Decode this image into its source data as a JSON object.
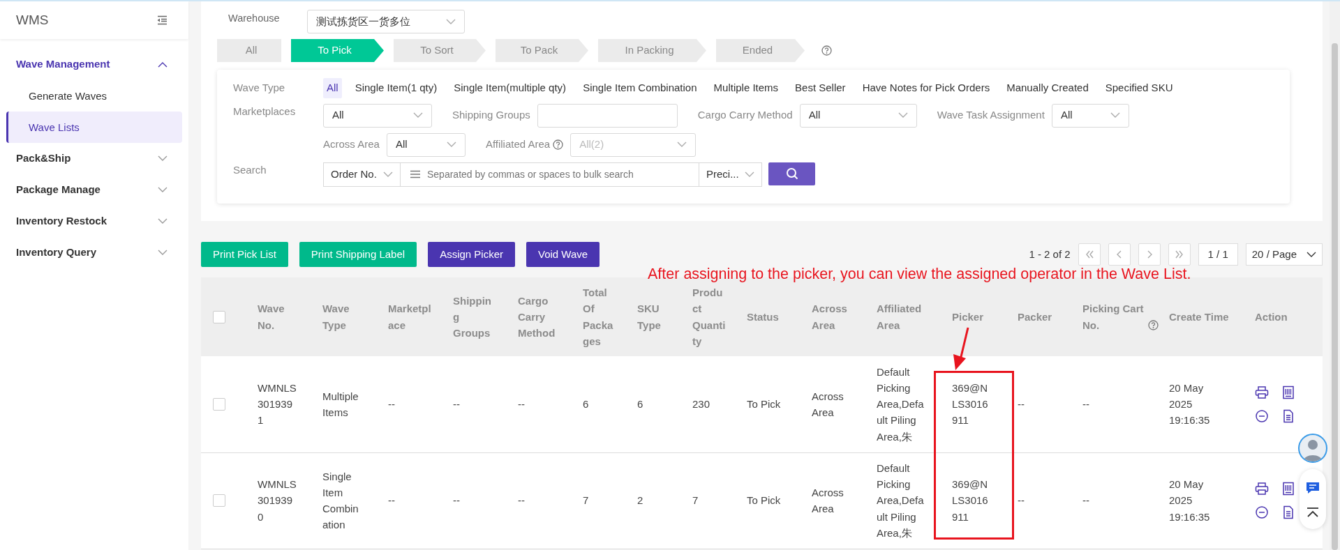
{
  "sidebar": {
    "title": "WMS",
    "items": [
      {
        "label": "Wave Management",
        "active": true,
        "expanded": true,
        "children": [
          {
            "label": "Generate Waves",
            "selected": false
          },
          {
            "label": "Wave Lists",
            "selected": true
          }
        ]
      },
      {
        "label": "Pack&Ship",
        "active": false,
        "expanded": false
      },
      {
        "label": "Package Manage",
        "active": false,
        "expanded": false
      },
      {
        "label": "Inventory Restock",
        "active": false,
        "expanded": false
      },
      {
        "label": "Inventory Query",
        "active": false,
        "expanded": false
      }
    ]
  },
  "warehouse": {
    "label": "Warehouse",
    "value": "测试拣货区一货多位"
  },
  "status_steps": [
    {
      "label": "All",
      "selected": false
    },
    {
      "label": "To Pick",
      "selected": true
    },
    {
      "label": "To Sort",
      "selected": false
    },
    {
      "label": "To Pack",
      "selected": false
    },
    {
      "label": "In Packing",
      "selected": false
    },
    {
      "label": "Ended",
      "selected": false
    }
  ],
  "filters": {
    "wave_type": {
      "label": "Wave Type",
      "options": [
        {
          "label": "All",
          "selected": true
        },
        {
          "label": "Single Item(1 qty)",
          "selected": false
        },
        {
          "label": "Single Item(multiple qty)",
          "selected": false
        },
        {
          "label": "Single Item Combination",
          "selected": false
        },
        {
          "label": "Multiple Items",
          "selected": false
        },
        {
          "label": "Best Seller",
          "selected": false
        },
        {
          "label": "Have Notes for Pick Orders",
          "selected": false
        },
        {
          "label": "Manually Created",
          "selected": false
        },
        {
          "label": "Specified SKU",
          "selected": false
        }
      ]
    },
    "rows": [
      {
        "label": "Marketplaces",
        "fields": [
          {
            "kind": "select",
            "value": "All",
            "disabled": false
          },
          {
            "kind": "input",
            "label": "Shipping Groups"
          },
          {
            "kind": "select",
            "label": "Cargo Carry Method",
            "value": "All",
            "disabled": false
          },
          {
            "kind": "select",
            "label": "Wave Task Assignment",
            "value": "All",
            "disabled": false
          }
        ]
      },
      {
        "fields": [
          {
            "kind": "select",
            "label": "Across Area",
            "value": "All",
            "disabled": false
          },
          {
            "kind": "select",
            "label": "Affiliated Area",
            "help": true,
            "value": "All(2)",
            "disabled": true
          }
        ]
      }
    ],
    "search": {
      "label": "Search",
      "field": "Order No.",
      "placeholder": "Separated by commas or spaces to bulk search",
      "match": "Preci..."
    }
  },
  "toolbar": [
    {
      "label": "Print Pick List",
      "kind": "success"
    },
    {
      "label": "Print Shipping Label",
      "kind": "success"
    },
    {
      "label": "Assign Picker",
      "kind": "primary"
    },
    {
      "label": "Void Wave",
      "kind": "primary"
    }
  ],
  "pagination": {
    "summary": "1 - 2 of 2",
    "page": "1 / 1",
    "page_size": "20 / Page"
  },
  "annotation": {
    "text": "After assigning to the picker, you can view the assigned operator in the Wave List."
  },
  "table": {
    "select_all_checked": false,
    "columns": [
      {
        "label": "Wave No."
      },
      {
        "label": "Wave Type"
      },
      {
        "label": "Marketplace"
      },
      {
        "label": "Shipping Groups"
      },
      {
        "label": "Cargo Carry Method"
      },
      {
        "label": "Total Of Packages"
      },
      {
        "label": "SKU Type"
      },
      {
        "label": "Product Quantity"
      },
      {
        "label": "Status"
      },
      {
        "label": "Across Area"
      },
      {
        "label": "Affiliated Area"
      },
      {
        "label": "Picker"
      },
      {
        "label": "Packer"
      },
      {
        "label": "Picking Cart No.",
        "help": true
      },
      {
        "label": "Create Time"
      },
      {
        "label": "Action"
      }
    ],
    "rows": [
      {
        "checked": false,
        "cells": [
          "WMNLS3019391",
          "Multiple Items",
          "--",
          "--",
          "--",
          "6",
          "6",
          "230",
          "To Pick",
          "Across Area",
          "Default Picking Area,Default Piling Area,朱",
          "369@NLS3016911",
          "--",
          "--",
          "20 May 2025 19:16:35"
        ]
      },
      {
        "checked": false,
        "cells": [
          "WMNLS3019390",
          "Single Item Combination",
          "--",
          "--",
          "--",
          "7",
          "2",
          "7",
          "To Pick",
          "Across Area",
          "Default Picking Area,Default Piling Area,朱",
          "369@NLS3016911",
          "--",
          "--",
          "20 May 2025 19:16:35"
        ]
      }
    ]
  }
}
